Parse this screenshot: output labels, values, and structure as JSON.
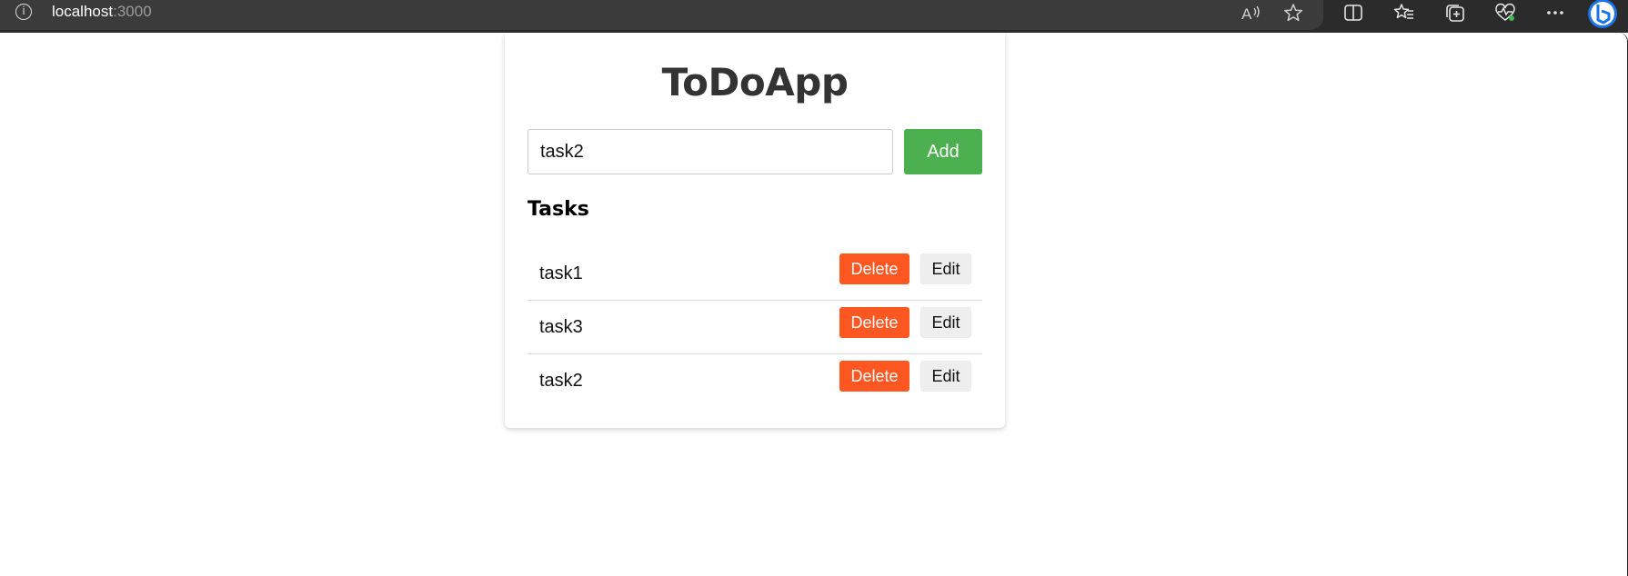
{
  "browser": {
    "url_host": "localhost",
    "url_port": ":3000",
    "toolbar_icons": [
      "read-aloud-icon",
      "favorite-star-icon",
      "split-screen-icon",
      "favorites-icon",
      "collections-icon",
      "browser-essentials-icon",
      "more-icon",
      "copilot-icon"
    ]
  },
  "app": {
    "title": "ToDoApp",
    "input_value": "task2",
    "add_label": "Add",
    "tasks_heading": "Tasks",
    "tasks": [
      {
        "name": "task1",
        "delete_label": "Delete",
        "edit_label": "Edit"
      },
      {
        "name": "task3",
        "delete_label": "Delete",
        "edit_label": "Edit"
      },
      {
        "name": "task2",
        "delete_label": "Delete",
        "edit_label": "Edit"
      }
    ]
  },
  "colors": {
    "add_button": "#4caf50",
    "delete_button": "#ff5722",
    "edit_button": "#eeeeee",
    "title_text": "#333333",
    "browser_chrome": "#2b2b2b"
  }
}
